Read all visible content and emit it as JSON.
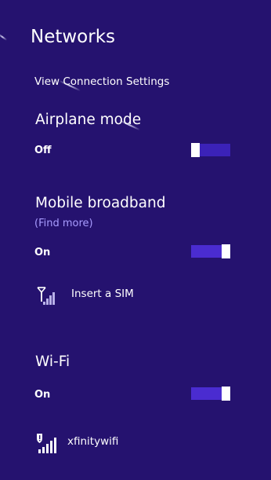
{
  "header": {
    "title": "Networks",
    "view_settings": "View Connection Settings"
  },
  "airplane": {
    "title": "Airplane mode",
    "state": "Off"
  },
  "mobile": {
    "title": "Mobile broadband",
    "find_more": "(Find more)",
    "state": "On",
    "network": "Insert a SIM"
  },
  "wifi": {
    "title": "Wi-Fi",
    "state": "On",
    "network": "xfinitywifi"
  },
  "icons": {
    "mobile_signal": "cellular-signal-icon",
    "wifi_signal": "wifi-secure-signal-icon"
  },
  "colors": {
    "background": "#25126f",
    "toggle_on": "#4a2cd0",
    "link": "#a89cff"
  }
}
